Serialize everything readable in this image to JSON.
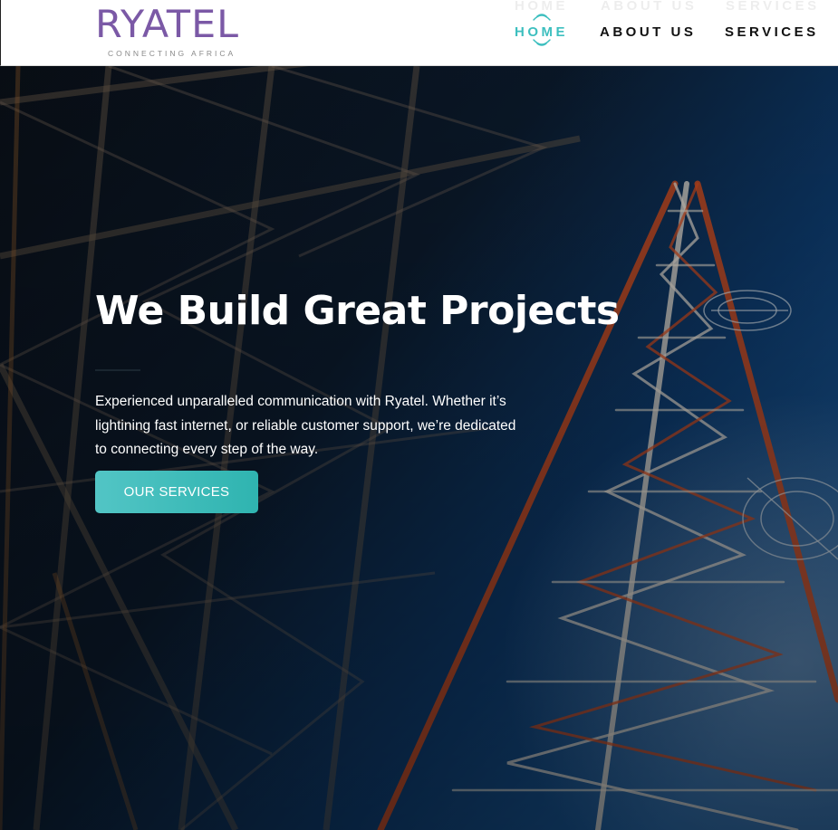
{
  "brand": {
    "name": "RYATEL",
    "tagline": "CONNECTING AFRICA",
    "color": "#7b59a6"
  },
  "nav": {
    "items": [
      {
        "label": "HOME",
        "active": true
      },
      {
        "label": "ABOUT US",
        "active": false
      },
      {
        "label": "SERVICES",
        "active": false
      }
    ],
    "active_color": "#3dbfbf"
  },
  "hero": {
    "title": "We Build Great Projects",
    "description": "Experienced unparalleled communication with Ryatel. Whether it’s lightining fast internet, or reliable customer support, we’re dedicated to connecting every step of the way.",
    "cta_label": "OUR SERVICES",
    "cta_color": "#3dbfbf",
    "background": "telecom-tower-photo"
  }
}
